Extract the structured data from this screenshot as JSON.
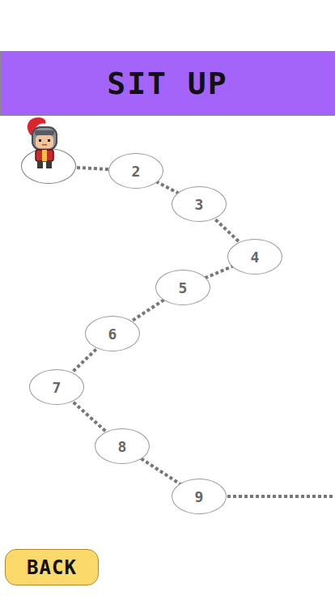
{
  "header": {
    "title": "SIT UP"
  },
  "levels": [
    {
      "kind": "hero",
      "label": "",
      "current": true
    },
    {
      "kind": "number",
      "label": "2",
      "current": false
    },
    {
      "kind": "number",
      "label": "3",
      "current": false
    },
    {
      "kind": "number",
      "label": "4",
      "current": false
    },
    {
      "kind": "number",
      "label": "5",
      "current": false
    },
    {
      "kind": "number",
      "label": "6",
      "current": false
    },
    {
      "kind": "number",
      "label": "7",
      "current": false
    },
    {
      "kind": "number",
      "label": "8",
      "current": false
    },
    {
      "kind": "number",
      "label": "9",
      "current": false
    }
  ],
  "buttons": [
    {
      "label": "BACK"
    }
  ]
}
